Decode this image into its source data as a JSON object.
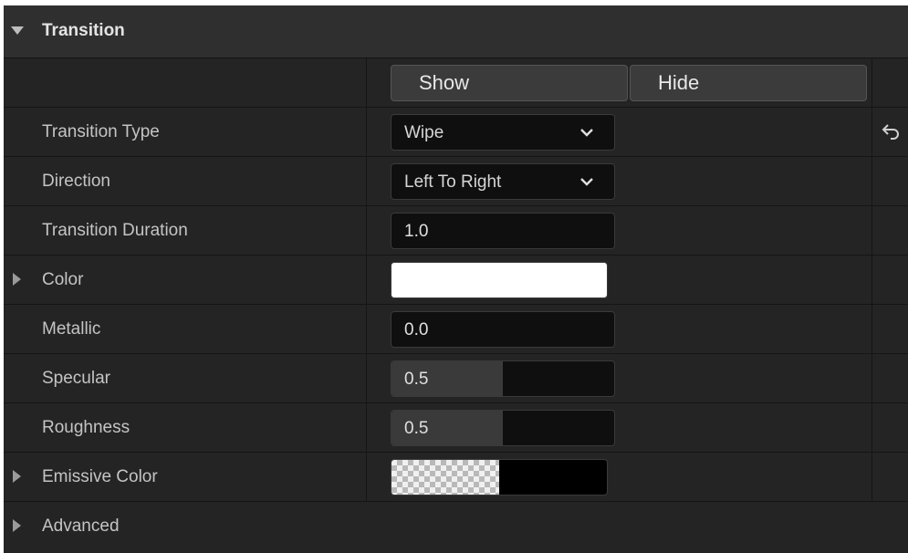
{
  "section": {
    "title": "Transition"
  },
  "visibility": {
    "show_label": "Show",
    "hide_label": "Hide"
  },
  "rows": {
    "transition_type": {
      "label": "Transition Type",
      "value": "Wipe"
    },
    "direction": {
      "label": "Direction",
      "value": "Left To Right"
    },
    "transition_duration": {
      "label": "Transition Duration",
      "value": "1.0"
    },
    "color": {
      "label": "Color",
      "swatch": "#ffffff"
    },
    "metallic": {
      "label": "Metallic",
      "value": "0.0",
      "fraction": 0.0
    },
    "specular": {
      "label": "Specular",
      "value": "0.5",
      "fraction": 0.5
    },
    "roughness": {
      "label": "Roughness",
      "value": "0.5",
      "fraction": 0.5
    },
    "emissive_color": {
      "label": "Emissive Color",
      "swatch": "#000000",
      "alpha": 1.0
    },
    "advanced": {
      "label": "Advanced"
    }
  },
  "icons": {
    "collapse": "triangle-down-icon",
    "expand": "triangle-right-icon",
    "dropdown": "chevron-down-icon",
    "reset": "reset-arrow-icon"
  },
  "colors": {
    "panel": "#1a1a1a",
    "row": "#242424",
    "header": "#2f2f2f",
    "input": "#0f0f0f",
    "slider_fill": "#3a3a3a"
  }
}
